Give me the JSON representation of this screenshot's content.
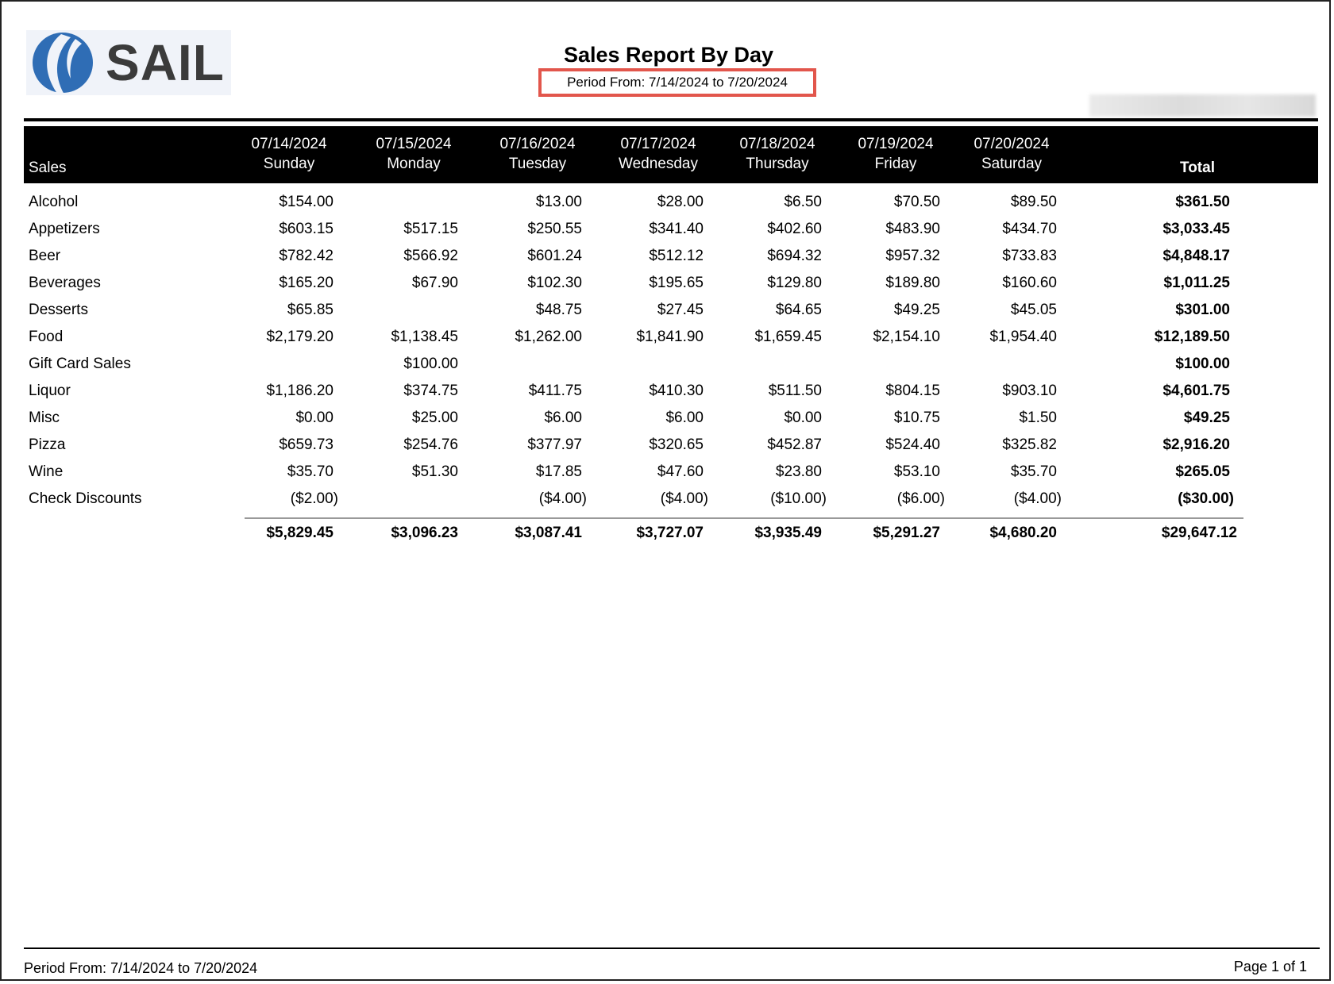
{
  "logo": {
    "text": "SAIL",
    "accent": "#2f6db5"
  },
  "report": {
    "title": "Sales Report By Day",
    "period": "Period From:  7/14/2024 to 7/20/2024",
    "highlight_color": "#e2564c"
  },
  "table": {
    "row_header": "Sales",
    "total_header": "Total",
    "days": [
      {
        "date": "07/14/2024",
        "weekday": "Sunday"
      },
      {
        "date": "07/15/2024",
        "weekday": "Monday"
      },
      {
        "date": "07/16/2024",
        "weekday": "Tuesday"
      },
      {
        "date": "07/17/2024",
        "weekday": "Wednesday"
      },
      {
        "date": "07/18/2024",
        "weekday": "Thursday"
      },
      {
        "date": "07/19/2024",
        "weekday": "Friday"
      },
      {
        "date": "07/20/2024",
        "weekday": "Saturday"
      }
    ],
    "rows": [
      {
        "label": "Alcohol",
        "values": [
          "$154.00",
          "",
          "$13.00",
          "$28.00",
          "$6.50",
          "$70.50",
          "$89.50"
        ],
        "total": "$361.50"
      },
      {
        "label": "Appetizers",
        "values": [
          "$603.15",
          "$517.15",
          "$250.55",
          "$341.40",
          "$402.60",
          "$483.90",
          "$434.70"
        ],
        "total": "$3,033.45"
      },
      {
        "label": "Beer",
        "values": [
          "$782.42",
          "$566.92",
          "$601.24",
          "$512.12",
          "$694.32",
          "$957.32",
          "$733.83"
        ],
        "total": "$4,848.17"
      },
      {
        "label": "Beverages",
        "values": [
          "$165.20",
          "$67.90",
          "$102.30",
          "$195.65",
          "$129.80",
          "$189.80",
          "$160.60"
        ],
        "total": "$1,011.25"
      },
      {
        "label": "Desserts",
        "values": [
          "$65.85",
          "",
          "$48.75",
          "$27.45",
          "$64.65",
          "$49.25",
          "$45.05"
        ],
        "total": "$301.00"
      },
      {
        "label": "Food",
        "values": [
          "$2,179.20",
          "$1,138.45",
          "$1,262.00",
          "$1,841.90",
          "$1,659.45",
          "$2,154.10",
          "$1,954.40"
        ],
        "total": "$12,189.50"
      },
      {
        "label": "Gift Card Sales",
        "values": [
          "",
          "$100.00",
          "",
          "",
          "",
          "",
          ""
        ],
        "total": "$100.00"
      },
      {
        "label": "Liquor",
        "values": [
          "$1,186.20",
          "$374.75",
          "$411.75",
          "$410.30",
          "$511.50",
          "$804.15",
          "$903.10"
        ],
        "total": "$4,601.75"
      },
      {
        "label": "Misc",
        "values": [
          "$0.00",
          "$25.00",
          "$6.00",
          "$6.00",
          "$0.00",
          "$10.75",
          "$1.50"
        ],
        "total": "$49.25"
      },
      {
        "label": "Pizza",
        "values": [
          "$659.73",
          "$254.76",
          "$377.97",
          "$320.65",
          "$452.87",
          "$524.40",
          "$325.82"
        ],
        "total": "$2,916.20"
      },
      {
        "label": "Wine",
        "values": [
          "$35.70",
          "$51.30",
          "$17.85",
          "$47.60",
          "$23.80",
          "$53.10",
          "$35.70"
        ],
        "total": "$265.05"
      },
      {
        "label": "Check Discounts",
        "values": [
          "($2.00)",
          "",
          "($4.00)",
          "($4.00)",
          "($10.00)",
          "($6.00)",
          "($4.00)"
        ],
        "total": "($30.00)"
      }
    ],
    "column_totals": [
      "$5,829.45",
      "$3,096.23",
      "$3,087.41",
      "$3,727.07",
      "$3,935.49",
      "$5,291.27",
      "$4,680.20"
    ],
    "grand_total": "$29,647.12"
  },
  "footer": {
    "period": "Period From:  7/14/2024 to 7/20/2024",
    "page": "Page 1 of 1"
  }
}
